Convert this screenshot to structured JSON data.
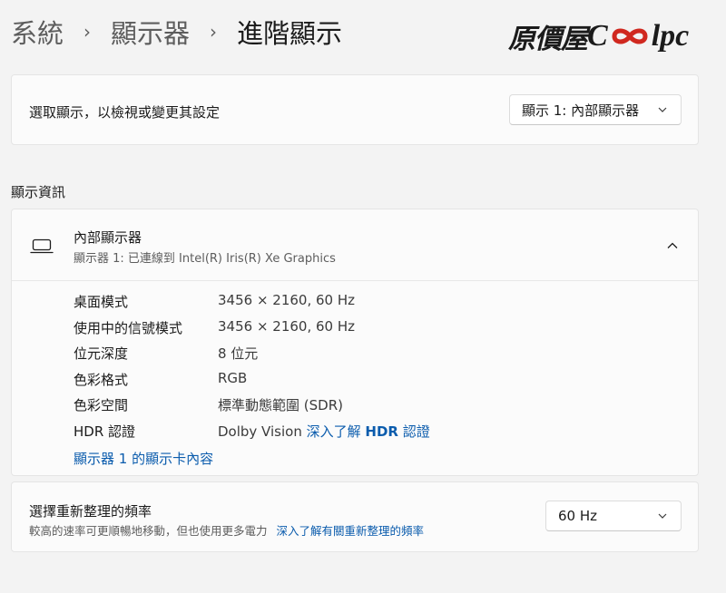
{
  "breadcrumb": {
    "items": [
      "系統",
      "顯示器",
      "進階顯示"
    ],
    "separator": "›"
  },
  "logo": {
    "zh": "原價屋",
    "en_prefix": "C",
    "en_suffix": "lpc"
  },
  "display_select": {
    "label": "選取顯示，以檢視或變更其設定",
    "value": "顯示 1: 內部顯示器"
  },
  "display_info": {
    "section_title": "顯示資訊",
    "title": "內部顯示器",
    "subtitle": "顯示器 1: 已連線到 Intel(R) Iris(R) Xe Graphics",
    "rows": [
      {
        "key": "桌面模式",
        "value": "3456 × 2160, 60 Hz"
      },
      {
        "key": "使用中的信號模式",
        "value": "3456 × 2160, 60 Hz"
      },
      {
        "key": "位元深度",
        "value": "8 位元"
      },
      {
        "key": "色彩格式",
        "value": "RGB"
      },
      {
        "key": "色彩空間",
        "value": "標準動態範圍 (SDR)"
      },
      {
        "key": "HDR 認證",
        "value": "Dolby Vision"
      }
    ],
    "hdr_link_prefix": "深入了解",
    "hdr_link_bold": "HDR",
    "hdr_link_suffix": "認證",
    "adapter_link": "顯示器 1 的顯示卡內容"
  },
  "refresh": {
    "title": "選擇重新整理的頻率",
    "description": "較高的速率可更順暢地移動，但也使用更多電力",
    "link": "深入了解有關重新整理的頻率",
    "value": "60 Hz"
  },
  "colors": {
    "accent": "#0b5cad",
    "background": "#f3f3f3",
    "card": "#fbfbfb"
  }
}
